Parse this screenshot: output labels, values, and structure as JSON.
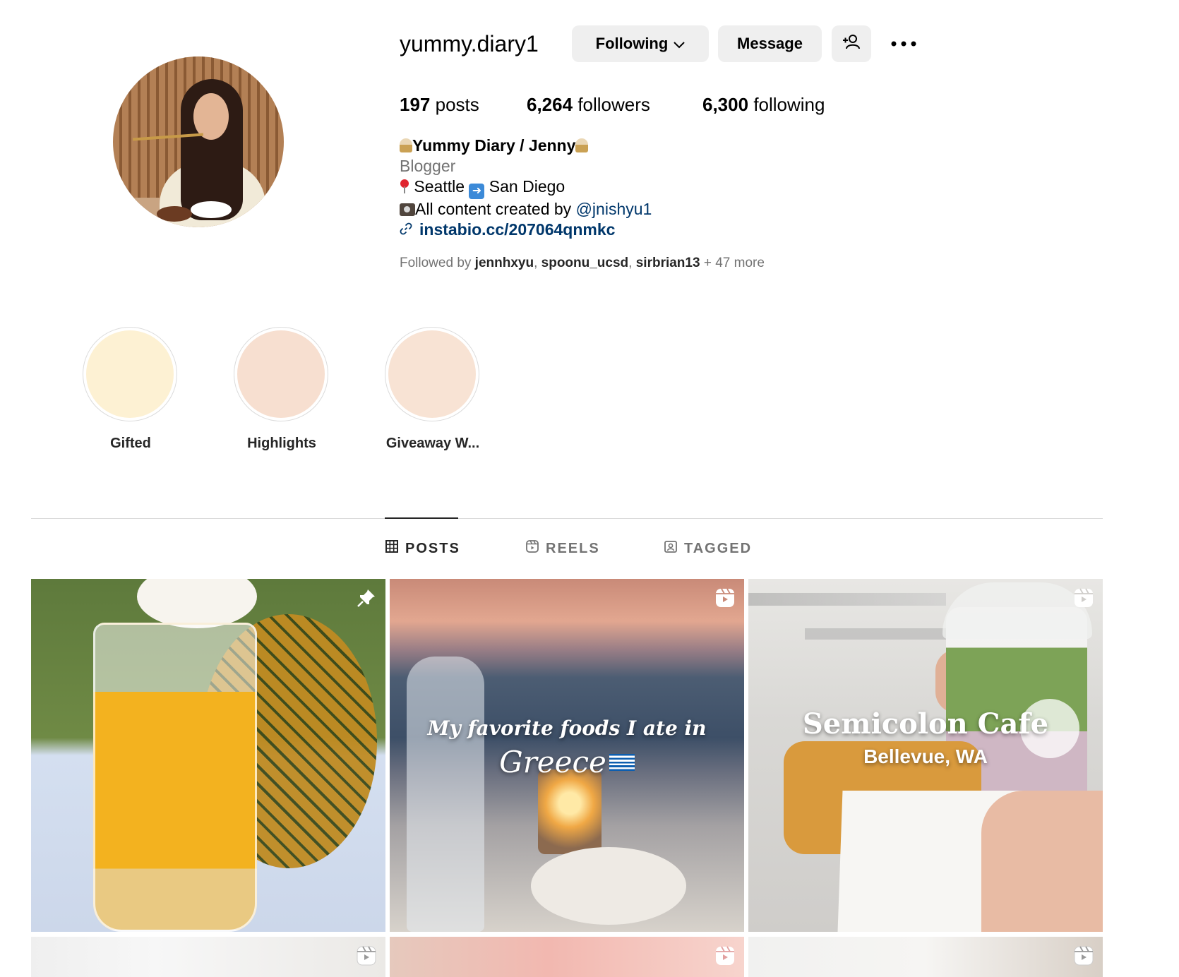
{
  "profile": {
    "username": "yummy.diary1",
    "buttons": {
      "following": "Following",
      "message": "Message"
    },
    "stats": {
      "posts_count": "197",
      "posts_label": "posts",
      "followers_count": "6,264",
      "followers_label": "followers",
      "following_count": "6,300",
      "following_label": "following"
    },
    "bio": {
      "display_name": "Yummy Diary / Jenny",
      "category": "Blogger",
      "location_from": "Seattle",
      "location_to": "San Diego",
      "credit_text": "All content created by ",
      "credit_mention": "@jnishyu1",
      "link": "instabio.cc/207064qnmkc"
    },
    "followed_by": {
      "prefix": "Followed by ",
      "users": [
        "jennhxyu",
        "spoonu_ucsd",
        "sirbrian13"
      ],
      "suffix": " + 47 more"
    }
  },
  "highlights": [
    {
      "label": "Gifted",
      "color": "#fdf1d3"
    },
    {
      "label": "Highlights",
      "color": "#f7dfd0"
    },
    {
      "label": "Giveaway W...",
      "color": "#f8e3d4"
    }
  ],
  "tabs": [
    {
      "label": "POSTS",
      "icon": "grid-icon",
      "active": true
    },
    {
      "label": "REELS",
      "icon": "reels-icon",
      "active": false
    },
    {
      "label": "TAGGED",
      "icon": "tagged-icon",
      "active": false
    }
  ],
  "posts": [
    {
      "type": "pinned",
      "icon": "pin-icon",
      "overlay": []
    },
    {
      "type": "reel",
      "icon": "reel-icon",
      "overlay": [
        "My favorite foods I ate in",
        "Greece"
      ]
    },
    {
      "type": "reel",
      "icon": "reel-icon",
      "overlay": [
        "Semicolon Cafe",
        "Bellevue, WA"
      ]
    },
    {
      "type": "reel",
      "icon": "reel-icon",
      "overlay": []
    },
    {
      "type": "reel",
      "icon": "reel-icon",
      "overlay": []
    },
    {
      "type": "reel",
      "icon": "reel-icon",
      "overlay": []
    }
  ],
  "colors": {
    "link": "#00376b",
    "muted": "#737373",
    "button_bg": "#efefef",
    "divider": "#dbdbdb"
  }
}
